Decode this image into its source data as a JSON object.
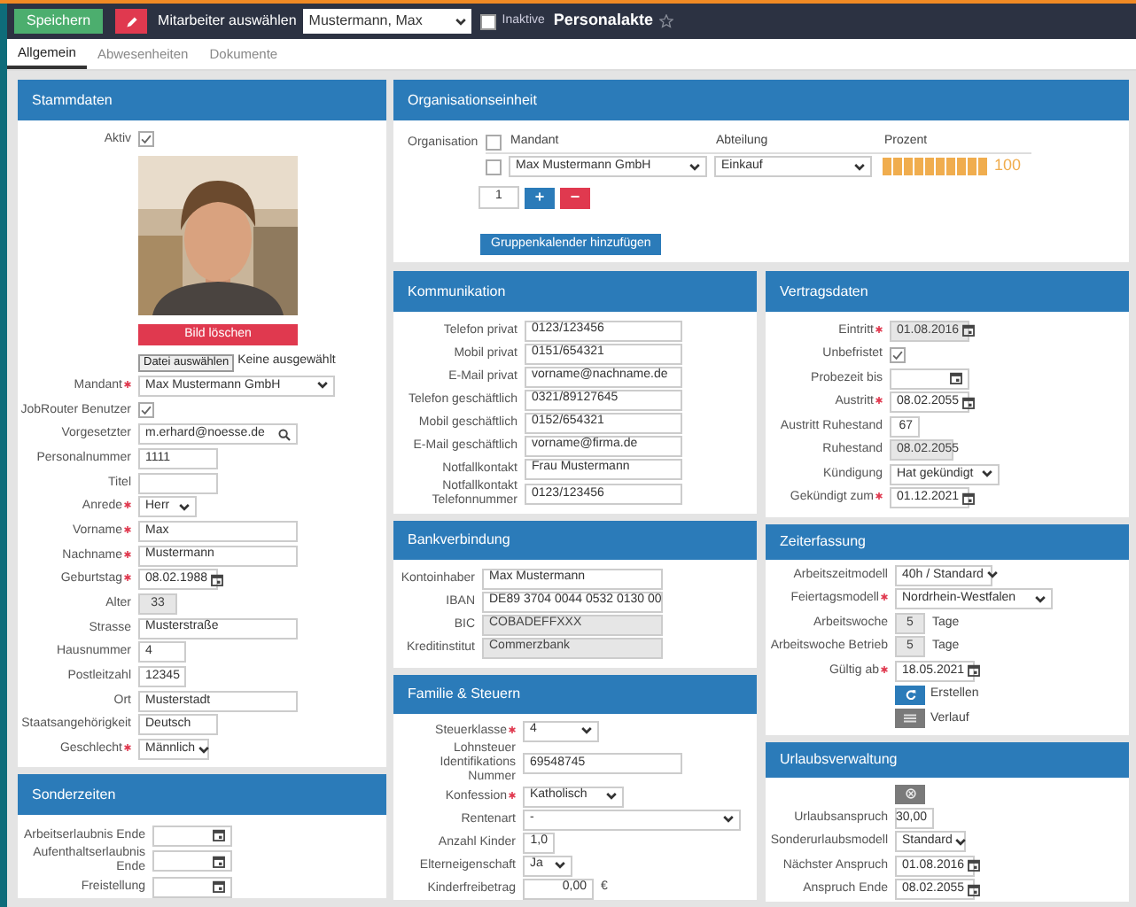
{
  "top_bar": {
    "save_button": "Speichern",
    "employee_label": "Mitarbeiter auswählen",
    "employee_select": "Mustermann, Max",
    "inactive": {
      "label": "Inaktive",
      "checked": false
    },
    "title": "Personalakte",
    "favorite": false
  },
  "tabs": [
    {
      "label": "Allgemein",
      "selected": true
    },
    {
      "label": "Abwesenheiten",
      "selected": false
    },
    {
      "label": "Dokumente",
      "selected": false
    }
  ],
  "stammdaten": {
    "title": "Stammdaten",
    "active": {
      "label": "Aktiv",
      "kind": "checkbox",
      "checked": true,
      "required": false,
      "disabled": false
    },
    "delete_photo_button": "Bild löschen",
    "file_input": {
      "button": "Datei auswählen",
      "status": "Keine ausgewählt"
    },
    "fields": [
      {
        "label": "Mandant",
        "kind": "select",
        "value": "Max Mustermann GmbH",
        "required": true,
        "disabled": false
      },
      {
        "label": "JobRouter Benutzer",
        "kind": "checkbox",
        "checked": true,
        "required": false,
        "disabled": false
      },
      {
        "label": "Vorgesetzter",
        "kind": "search",
        "value": "m.erhard@noesse.de",
        "required": false,
        "disabled": false
      },
      {
        "label": "Personalnummer",
        "kind": "text",
        "value": "1111",
        "required": false,
        "disabled": false
      },
      {
        "label": "Titel",
        "kind": "text",
        "required": false,
        "disabled": false
      },
      {
        "label": "Anrede",
        "kind": "select",
        "value": "Herr",
        "required": true,
        "disabled": false
      },
      {
        "label": "Vorname",
        "kind": "text",
        "value": "Max",
        "required": true,
        "disabled": false
      },
      {
        "label": "Nachname",
        "kind": "text",
        "value": "Mustermann",
        "required": true,
        "disabled": false
      },
      {
        "label": "Geburtstag",
        "kind": "date",
        "value": "08.02.1988",
        "required": true,
        "disabled": false
      },
      {
        "label": "Alter",
        "kind": "number",
        "value": "33",
        "required": false,
        "disabled": true
      },
      {
        "label": "Strasse",
        "kind": "text",
        "value": "Musterstraße",
        "required": false,
        "disabled": false
      },
      {
        "label": "Hausnummer",
        "kind": "text",
        "value": "4",
        "required": false,
        "disabled": false
      },
      {
        "label": "Postleitzahl",
        "kind": "text",
        "value": "12345",
        "required": false,
        "disabled": false
      },
      {
        "label": "Ort",
        "kind": "text",
        "value": "Musterstadt",
        "required": false,
        "disabled": false
      },
      {
        "label": "Staatsangehörigkeit",
        "kind": "text",
        "value": "Deutsch",
        "required": false,
        "disabled": false
      },
      {
        "label": "Geschlecht",
        "kind": "select",
        "value": "Männlich",
        "required": true,
        "disabled": false
      }
    ]
  },
  "sonderzeiten": {
    "title": "Sonderzeiten",
    "fields": [
      {
        "label": "Arbeitserlaubnis Ende",
        "kind": "date",
        "required": false,
        "disabled": false
      },
      {
        "label": "Aufenthaltserlaubnis Ende",
        "kind": "date",
        "required": false,
        "disabled": false
      },
      {
        "label": "Freistellung",
        "kind": "date",
        "required": false,
        "disabled": false
      }
    ]
  },
  "organisationseinheit": {
    "title": "Organisationseinheit",
    "label": "Organisation",
    "header_checkbox": {
      "checked": false
    },
    "columns": [
      "Mandant",
      "Abteilung",
      "Prozent"
    ],
    "rows": [
      {
        "checked": false,
        "mandant": "Max Mustermann GmbH",
        "abteilung": "Einkauf",
        "level": 1,
        "percent": "100"
      }
    ],
    "count": "1",
    "add_button": "+",
    "remove_button": "−",
    "group_button": "Gruppenkalender hinzufügen"
  },
  "kommunikation": {
    "title": "Kommunikation",
    "fields": [
      {
        "label": "Telefon privat",
        "kind": "text",
        "value": "0123/123456",
        "required": false,
        "disabled": false
      },
      {
        "label": "Mobil privat",
        "kind": "text",
        "value": "0151/654321",
        "required": false,
        "disabled": false
      },
      {
        "label": "E-Mail privat",
        "kind": "text",
        "value": "vorname@nachname.de",
        "required": false,
        "disabled": false
      },
      {
        "label": "Telefon geschäftlich",
        "kind": "text",
        "value": "0321/89127645",
        "required": false,
        "disabled": false
      },
      {
        "label": "Mobil geschäftlich",
        "kind": "text",
        "value": "0152/654321",
        "required": false,
        "disabled": false
      },
      {
        "label": "E-Mail geschäftlich",
        "kind": "text",
        "value": "vorname@firma.de",
        "required": false,
        "disabled": false
      },
      {
        "label": "Notfallkontakt",
        "kind": "text",
        "value": "Frau Mustermann",
        "required": false,
        "disabled": false
      },
      {
        "label": "Notfallkontakt Telefonnummer",
        "kind": "text",
        "value": "0123/123456",
        "required": false,
        "disabled": false
      }
    ]
  },
  "bankverbindung": {
    "title": "Bankverbindung",
    "fields": [
      {
        "label": "Kontoinhaber",
        "kind": "text",
        "value": "Max Mustermann",
        "required": false,
        "disabled": false
      },
      {
        "label": "IBAN",
        "kind": "text",
        "value": "DE89 3704 0044 0532 0130 00",
        "required": false,
        "disabled": false
      },
      {
        "label": "BIC",
        "kind": "text",
        "value": "COBADEFFXXX",
        "required": false,
        "disabled": true
      },
      {
        "label": "Kreditinstitut",
        "kind": "text",
        "value": "Commerzbank",
        "required": false,
        "disabled": true
      }
    ]
  },
  "familie_steuern": {
    "title": "Familie & Steuern",
    "fields": [
      {
        "label": "Steuerklasse",
        "kind": "select",
        "value": "4",
        "required": true,
        "disabled": false
      },
      {
        "label": "Lohnsteuer Identifikations Nummer",
        "kind": "text",
        "value": "69548745",
        "required": false,
        "disabled": false
      },
      {
        "label": "Konfession",
        "kind": "select",
        "value": "Katholisch",
        "required": true,
        "disabled": false
      },
      {
        "label": "Rentenart",
        "kind": "select",
        "value": "-",
        "required": false,
        "disabled": false
      },
      {
        "label": "Anzahl Kinder",
        "kind": "number",
        "value": "1,0",
        "required": false,
        "disabled": false
      },
      {
        "label": "Elterneigenschaft",
        "kind": "select",
        "value": "Ja",
        "required": false,
        "disabled": false
      },
      {
        "label": "Kinderfreibetrag",
        "kind": "number",
        "value": "0,00",
        "suffix": "€",
        "required": false,
        "disabled": false
      }
    ]
  },
  "vertragsdaten": {
    "title": "Vertragsdaten",
    "fields": [
      {
        "label": "Eintritt",
        "kind": "date",
        "value": "01.08.2016",
        "required": true,
        "disabled": true
      },
      {
        "label": "Unbefristet",
        "kind": "checkbox",
        "checked": true,
        "required": false,
        "disabled": false
      },
      {
        "label": "Probezeit bis",
        "kind": "date",
        "required": false,
        "disabled": false
      },
      {
        "label": "Austritt",
        "kind": "date",
        "value": "08.02.2055",
        "required": true,
        "disabled": false
      },
      {
        "label": "Austritt Ruhestand",
        "kind": "number",
        "value": "67",
        "required": false,
        "disabled": false
      },
      {
        "label": "Ruhestand",
        "kind": "text",
        "value": "08.02.2055",
        "required": false,
        "disabled": true
      },
      {
        "label": "Kündigung",
        "kind": "select",
        "value": "Hat gekündigt",
        "required": false,
        "disabled": false
      },
      {
        "label": "Gekündigt zum",
        "kind": "date",
        "value": "01.12.2021",
        "required": true,
        "disabled": false
      }
    ]
  },
  "zeiterfassung": {
    "title": "Zeiterfassung",
    "fields": [
      {
        "label": "Arbeitszeitmodell",
        "kind": "select",
        "value": "40h / Standard",
        "required": false,
        "disabled": false
      },
      {
        "label": "Feiertagsmodell",
        "kind": "select",
        "value": "Nordrhein-Westfalen",
        "required": true,
        "disabled": false
      },
      {
        "label": "Arbeitswoche",
        "kind": "number",
        "value": "5",
        "suffix": "Tage",
        "required": false,
        "disabled": true
      },
      {
        "label": "Arbeitswoche Betrieb",
        "kind": "number",
        "value": "5",
        "suffix": "Tage",
        "required": false,
        "disabled": true
      },
      {
        "label": "Gültig ab",
        "kind": "date",
        "value": "18.05.2021",
        "required": true,
        "disabled": false
      },
      {
        "kind": "create",
        "text": "Erstellen",
        "disabled": false
      },
      {
        "kind": "history",
        "text": "Verlauf",
        "disabled": false
      }
    ]
  },
  "urlaubsverwaltung": {
    "title": "Urlaubsverwaltung",
    "fields": [
      {
        "kind": "icon_button",
        "disabled": false
      },
      {
        "label": "Urlaubsanspruch",
        "kind": "number",
        "value": "30,00",
        "required": false,
        "disabled": false
      },
      {
        "label": "Sonderurlaubsmodell",
        "kind": "select",
        "value": "Standard",
        "required": false,
        "disabled": false
      },
      {
        "label": "Nächster Anspruch",
        "kind": "date",
        "value": "01.08.2016",
        "required": false,
        "disabled": false
      },
      {
        "label": "Anspruch Ende",
        "kind": "date",
        "value": "08.02.2055",
        "required": false,
        "disabled": false
      }
    ]
  }
}
